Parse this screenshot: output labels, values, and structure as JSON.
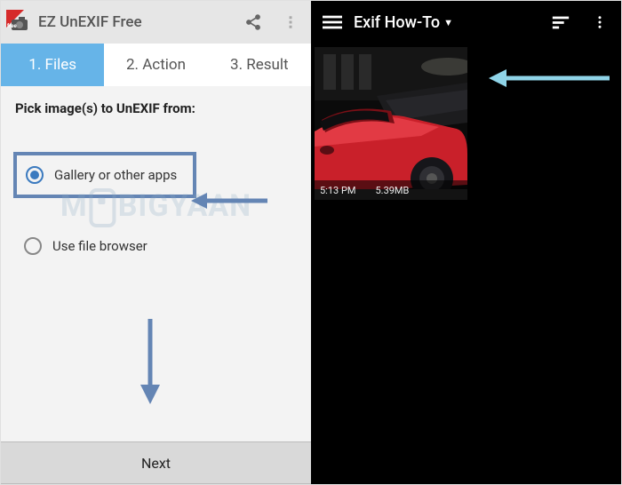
{
  "left": {
    "app_title": "EZ UnEXIF Free",
    "tabs": {
      "files": "1. Files",
      "action": "2. Action",
      "result": "3. Result"
    },
    "prompt": "Pick image(s) to UnEXIF from:",
    "options": {
      "gallery": "Gallery or other apps",
      "browser": "Use file browser"
    },
    "next_label": "Next"
  },
  "right": {
    "title": "Exif How-To",
    "thumb": {
      "time": "5:13 PM",
      "size": "5.39MB"
    }
  },
  "watermark": {
    "left": "M",
    "right": "BIGYAAN"
  },
  "colors": {
    "tab_active": "#66b4e8",
    "arrow": "#6485b4",
    "arrow_light": "#8fd4e8"
  }
}
